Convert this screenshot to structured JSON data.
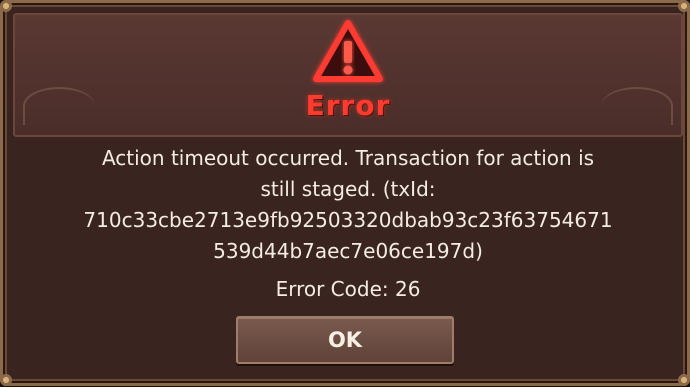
{
  "dialog": {
    "title": "Error",
    "message_lines": [
      "Action timeout occurred. Transaction for action is",
      "still staged. (txId:",
      "710c33cbe2713e9fb92503320dbab93c23f63754671",
      "539d44b7aec7e06ce197d)"
    ],
    "error_code": "Error Code: 26",
    "ok_label": "OK",
    "icon": "warning-triangle-icon"
  },
  "colors": {
    "title": "#ff3b30",
    "background": "#3a2420",
    "header": "#4a2d29",
    "button": "#6b4c41",
    "text": "#f2ece2"
  }
}
